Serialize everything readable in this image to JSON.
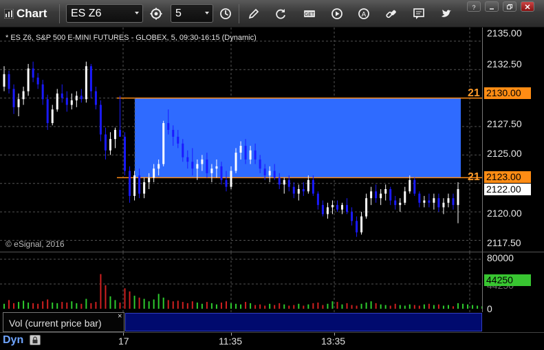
{
  "toolbar": {
    "title": "Chart",
    "symbol": "ES Z6",
    "interval": "5",
    "icons": [
      "settings-gear-icon",
      "clock-icon",
      "pencil-icon",
      "refresh-icon",
      "get-icon",
      "play-icon",
      "alert-icon",
      "link-icon",
      "notes-icon",
      "twitter-icon"
    ]
  },
  "window_controls": [
    "help-icon",
    "minimize-icon",
    "restore-icon",
    "close-icon"
  ],
  "chart_title": "* ES Z6, S&P 500 E-MINI FUTURES - GLOBEX, 5, 09:30-16:15 (Dynamic)",
  "copyright": "© eSignal, 2016",
  "colors": {
    "up": "#ffffff",
    "down": "#1a1aff",
    "zone": "#2f6bff",
    "level_line": "#ff8c14",
    "vol_up": "#2ecc2e",
    "vol_down": "#d02020"
  },
  "price_axis": {
    "labels": [
      "2135.00",
      "2132.50",
      "2130.00",
      "2127.50",
      "2125.00",
      "2122.00",
      "2120.00",
      "2117.50"
    ],
    "upper_level": "2130.00",
    "upper_level_text": "21",
    "lower_level": "2123.00",
    "lower_level_text": "21",
    "last_price": "2122.00"
  },
  "volume_axis": {
    "labels": [
      "80000",
      "44250",
      "0"
    ],
    "current_volume": "44250"
  },
  "study": {
    "label": "Vol (current price bar)",
    "close": "×"
  },
  "time_axis": {
    "mode": "Dyn",
    "labels": [
      "17",
      "11:35",
      "13:35"
    ]
  },
  "chart_data": {
    "type": "candlestick",
    "ylim": [
      2116.5,
      2136.2
    ],
    "zone": {
      "low": 2123.0,
      "high": 2130.0
    },
    "candles": [
      [
        2131.0,
        2132.8,
        2130.6,
        2132.1
      ],
      [
        2132.1,
        2132.4,
        2130.4,
        2130.8
      ],
      [
        2130.8,
        2131.2,
        2128.6,
        2129.2
      ],
      [
        2129.2,
        2130.4,
        2128.4,
        2129.9
      ],
      [
        2129.9,
        2131.0,
        2129.4,
        2130.6
      ],
      [
        2130.6,
        2133.0,
        2130.2,
        2132.6
      ],
      [
        2132.6,
        2133.2,
        2131.4,
        2131.8
      ],
      [
        2131.8,
        2132.2,
        2130.8,
        2131.2
      ],
      [
        2131.2,
        2131.6,
        2129.4,
        2129.9
      ],
      [
        2129.9,
        2130.3,
        2127.2,
        2127.8
      ],
      [
        2127.8,
        2129.4,
        2127.6,
        2129.0
      ],
      [
        2129.0,
        2130.8,
        2128.8,
        2130.4
      ],
      [
        2130.4,
        2131.2,
        2129.6,
        2130.0
      ],
      [
        2130.0,
        2130.6,
        2128.8,
        2129.4
      ],
      [
        2129.4,
        2130.4,
        2129.0,
        2129.8
      ],
      [
        2129.8,
        2130.6,
        2129.2,
        2130.2
      ],
      [
        2130.2,
        2130.8,
        2129.6,
        2129.9
      ],
      [
        2129.9,
        2133.2,
        2129.6,
        2132.8
      ],
      [
        2132.8,
        2133.0,
        2130.0,
        2130.6
      ],
      [
        2130.6,
        2131.0,
        2129.0,
        2129.4
      ],
      [
        2129.4,
        2129.8,
        2126.2,
        2126.8
      ],
      [
        2126.8,
        2127.4,
        2124.6,
        2125.4
      ],
      [
        2125.4,
        2127.0,
        2125.0,
        2126.4
      ],
      [
        2126.4,
        2127.4,
        2125.6,
        2127.2
      ],
      [
        2127.2,
        2130.2,
        2126.8,
        2126.6
      ],
      [
        2126.6,
        2127.0,
        2123.2,
        2123.6
      ],
      [
        2123.6,
        2124.0,
        2120.8,
        2121.4
      ],
      [
        2121.4,
        2123.6,
        2121.0,
        2123.2
      ],
      [
        2123.2,
        2123.8,
        2121.2,
        2121.6
      ],
      [
        2121.6,
        2123.0,
        2121.2,
        2122.6
      ],
      [
        2122.6,
        2123.4,
        2122.0,
        2123.0
      ],
      [
        2123.0,
        2124.2,
        2122.6,
        2123.8
      ],
      [
        2123.8,
        2124.6,
        2123.2,
        2124.2
      ],
      [
        2124.2,
        2128.0,
        2124.0,
        2127.8
      ],
      [
        2127.8,
        2129.0,
        2126.8,
        2127.2
      ],
      [
        2127.2,
        2127.6,
        2125.8,
        2126.6
      ],
      [
        2126.6,
        2127.2,
        2125.6,
        2126.0
      ],
      [
        2126.0,
        2126.4,
        2124.4,
        2124.8
      ],
      [
        2124.8,
        2125.4,
        2123.8,
        2124.4
      ],
      [
        2124.4,
        2125.6,
        2123.2,
        2123.8
      ],
      [
        2123.8,
        2124.6,
        2122.8,
        2124.2
      ],
      [
        2124.2,
        2125.0,
        2123.6,
        2124.6
      ],
      [
        2124.6,
        2125.2,
        2123.0,
        2123.4
      ],
      [
        2123.4,
        2124.2,
        2122.6,
        2123.8
      ],
      [
        2123.8,
        2124.6,
        2123.0,
        2124.0
      ],
      [
        2124.0,
        2124.4,
        2122.4,
        2122.8
      ],
      [
        2122.8,
        2123.6,
        2121.8,
        2122.2
      ],
      [
        2122.2,
        2124.0,
        2122.0,
        2123.6
      ],
      [
        2123.6,
        2125.6,
        2123.4,
        2125.2
      ],
      [
        2125.2,
        2126.2,
        2124.6,
        2125.8
      ],
      [
        2125.8,
        2126.4,
        2124.2,
        2124.6
      ],
      [
        2124.6,
        2125.8,
        2124.2,
        2125.4
      ],
      [
        2125.4,
        2126.0,
        2124.2,
        2124.6
      ],
      [
        2124.6,
        2125.0,
        2123.4,
        2123.8
      ],
      [
        2123.8,
        2124.2,
        2122.8,
        2123.2
      ],
      [
        2123.2,
        2124.0,
        2122.6,
        2123.6
      ],
      [
        2123.6,
        2124.2,
        2122.8,
        2123.0
      ],
      [
        2123.0,
        2123.4,
        2122.0,
        2122.4
      ],
      [
        2122.4,
        2123.0,
        2121.6,
        2122.8
      ],
      [
        2122.8,
        2123.2,
        2121.8,
        2122.2
      ],
      [
        2122.2,
        2122.6,
        2121.2,
        2121.6
      ],
      [
        2121.6,
        2122.4,
        2121.0,
        2122.0
      ],
      [
        2122.0,
        2122.6,
        2121.4,
        2121.8
      ],
      [
        2121.8,
        2123.2,
        2121.6,
        2122.8
      ],
      [
        2122.8,
        2123.2,
        2121.4,
        2121.6
      ],
      [
        2121.6,
        2121.8,
        2120.2,
        2120.6
      ],
      [
        2120.6,
        2121.0,
        2119.6,
        2119.8
      ],
      [
        2119.8,
        2120.8,
        2119.4,
        2120.4
      ],
      [
        2120.4,
        2121.0,
        2119.8,
        2120.6
      ],
      [
        2120.6,
        2121.0,
        2120.0,
        2120.2
      ],
      [
        2120.2,
        2120.8,
        2119.8,
        2120.6
      ],
      [
        2120.6,
        2121.2,
        2119.8,
        2120.0
      ],
      [
        2120.0,
        2120.4,
        2118.8,
        2119.2
      ],
      [
        2119.2,
        2119.6,
        2117.8,
        2118.2
      ],
      [
        2118.2,
        2120.0,
        2118.0,
        2119.6
      ],
      [
        2119.6,
        2121.6,
        2119.4,
        2121.2
      ],
      [
        2121.2,
        2122.2,
        2120.6,
        2121.8
      ],
      [
        2121.8,
        2122.4,
        2120.8,
        2121.2
      ],
      [
        2121.2,
        2122.0,
        2120.6,
        2121.6
      ],
      [
        2121.6,
        2122.4,
        2121.0,
        2122.0
      ],
      [
        2122.0,
        2122.2,
        2120.6,
        2121.0
      ],
      [
        2121.0,
        2121.4,
        2120.2,
        2120.6
      ],
      [
        2120.6,
        2121.2,
        2120.0,
        2120.8
      ],
      [
        2120.8,
        2122.2,
        2120.6,
        2121.8
      ],
      [
        2121.8,
        2123.2,
        2121.6,
        2122.8
      ],
      [
        2122.8,
        2123.0,
        2121.4,
        2121.6
      ],
      [
        2121.6,
        2121.8,
        2120.4,
        2120.8
      ],
      [
        2120.8,
        2121.4,
        2120.4,
        2121.0
      ],
      [
        2121.0,
        2121.6,
        2120.4,
        2120.8
      ],
      [
        2120.8,
        2121.6,
        2120.2,
        2121.2
      ],
      [
        2121.2,
        2121.6,
        2120.0,
        2120.4
      ],
      [
        2120.4,
        2121.2,
        2119.8,
        2120.8
      ],
      [
        2120.8,
        2121.6,
        2120.4,
        2121.2
      ],
      [
        2121.2,
        2121.6,
        2120.2,
        2120.6
      ],
      [
        2120.6,
        2122.6,
        2119.0,
        2122.0
      ]
    ],
    "volumes": [
      8000,
      14000,
      9000,
      11000,
      13000,
      10000,
      9000,
      8000,
      12000,
      15000,
      10000,
      9000,
      11000,
      10000,
      12000,
      9000,
      8000,
      16000,
      9000,
      11000,
      56000,
      38000,
      20000,
      14000,
      10000,
      33000,
      28000,
      21000,
      18000,
      16000,
      12000,
      15000,
      24000,
      18000,
      14000,
      12000,
      13000,
      11000,
      9000,
      12000,
      10000,
      8000,
      11000,
      9000,
      7000,
      10000,
      12000,
      9000,
      8000,
      7000,
      11000,
      9000,
      6000,
      7000,
      5000,
      8000,
      6000,
      9000,
      7000,
      5000,
      6000,
      8000,
      5000,
      7000,
      9000,
      10000,
      6000,
      8000,
      12000,
      11000,
      7000,
      9000,
      6000,
      5000,
      8000,
      10000,
      12000,
      9000,
      7000,
      6000,
      5000,
      8000,
      6000,
      5000,
      7000,
      6000,
      5000,
      7000,
      8000,
      6000,
      7000,
      5000,
      6000,
      4000,
      9000,
      8000,
      7000,
      6000,
      5000,
      4000,
      45000,
      44250
    ]
  }
}
